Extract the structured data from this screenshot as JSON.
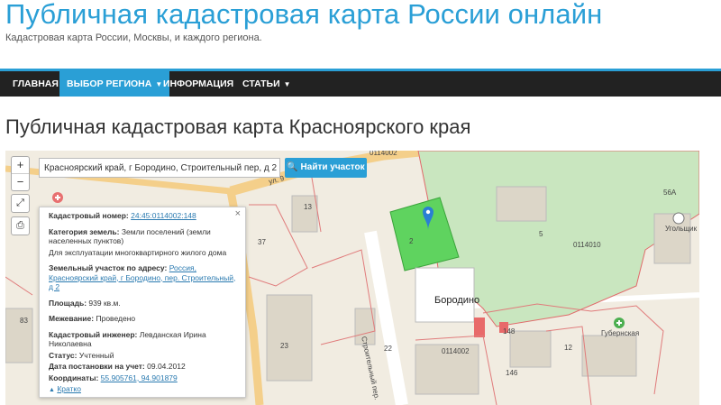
{
  "header": {
    "site_title": "Публичная кадастровая карта России онлайн",
    "site_subtitle": "Кадастровая карта России, Москвы, и каждого региона."
  },
  "nav": {
    "items": [
      {
        "label": "ГЛАВНАЯ"
      },
      {
        "label": "ВЫБОР РЕГИОНА"
      },
      {
        "label": "ИНФОРМАЦИЯ"
      },
      {
        "label": "СТАТЬИ"
      }
    ]
  },
  "page": {
    "heading": "Публичная кадастровая карта Красноярского края"
  },
  "map": {
    "zoom_in": "+",
    "zoom_out": "−",
    "search_value": "Красноярский край, г Бородино, Строительный пер, д 2",
    "search_button": "Найти участок",
    "labels": {
      "street_ul": "ул. 9",
      "street_stroit": "Строительный пер.",
      "borodino": "Бородино",
      "gubernskaya": "Губернская",
      "ugolshchik": "Угольщик",
      "quarter_1": "0114002",
      "quarter_2": "0114010",
      "num_56a": "56А",
      "num_37": "37",
      "num_83": "83",
      "num_23": "23",
      "num_5": "5",
      "num_2": "2",
      "num_13": "13",
      "num_22": "22",
      "num_146": "146",
      "num_148": "148",
      "num_12": "12"
    },
    "accent_green": "#5fd35f",
    "park_green": "#c9e6bf"
  },
  "info_panel": {
    "cad_number_label": "Кадастровый номер:",
    "cad_number_value": "24:45:0114002:148",
    "category_label": "Категория земель:",
    "category_value": "Земли поселений (земли населенных пунктов)",
    "use_value": "Для эксплуатации многоквартирного жилого дома",
    "address_label": "Земельный участок по адресу:",
    "address_value": "Россия, Красноярский край, г Бородино, пер. Строительный, д 2",
    "area_label": "Площадь:",
    "area_value": "939 кв.м.",
    "survey_label": "Межевание:",
    "survey_value": "Проведено",
    "engineer_label": "Кадастровый инженер:",
    "engineer_value": "Левданская Ирина Николаевна",
    "status_label": "Статус:",
    "status_value": "Учтенный",
    "date_label": "Дата постановки на учет:",
    "date_value": "09.04.2012",
    "coords_label": "Координаты:",
    "coords_value": "55.905761, 94.901879",
    "brief_link": "Кратко",
    "close": "×"
  }
}
